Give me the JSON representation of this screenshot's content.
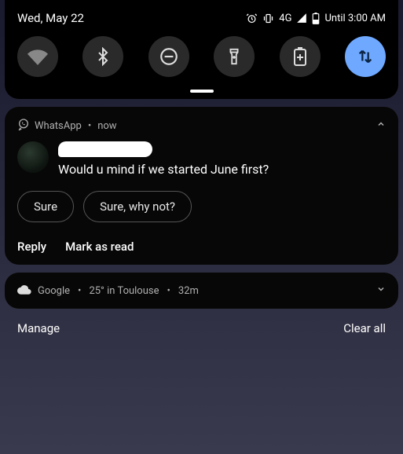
{
  "status": {
    "date": "Wed, May 22",
    "net": "4G",
    "dnd_until": "Until 3:00 AM"
  },
  "quick_settings": {
    "tiles": [
      {
        "name": "wifi",
        "active": false
      },
      {
        "name": "bluetooth",
        "active": false
      },
      {
        "name": "dnd",
        "active": false
      },
      {
        "name": "flashlight",
        "active": false
      },
      {
        "name": "battery-saver",
        "active": false
      },
      {
        "name": "data-swap",
        "active": true
      }
    ]
  },
  "notification": {
    "app": "WhatsApp",
    "time": "now",
    "message": "Would u mind if we started June first?",
    "smart_replies": [
      "Sure",
      "Sure, why not?"
    ],
    "actions": {
      "reply": "Reply",
      "mark_read": "Mark as read"
    }
  },
  "weather": {
    "app": "Google",
    "summary": "25° in Toulouse",
    "age": "32m"
  },
  "footer": {
    "manage": "Manage",
    "clear": "Clear all"
  }
}
